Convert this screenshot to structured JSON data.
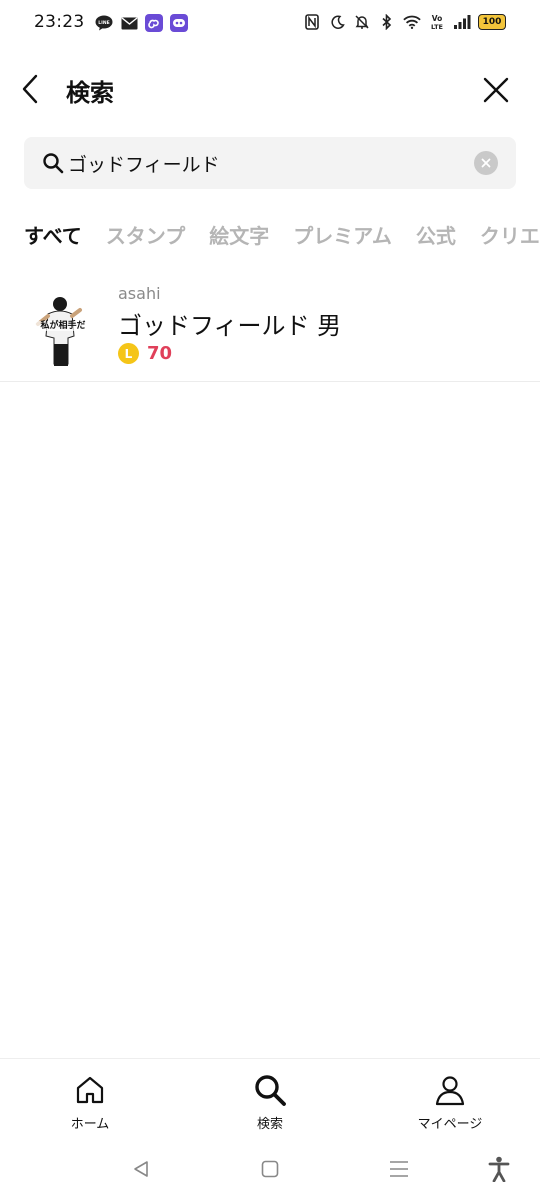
{
  "status_bar": {
    "time": "23:23",
    "battery": "100",
    "left_icons": [
      "line-app-icon",
      "mail-icon",
      "link-app-icon",
      "chat-app-icon"
    ],
    "right_icons": [
      "nfc-icon",
      "moon-icon",
      "mute-icon",
      "bluetooth-icon",
      "wifi-icon",
      "volte-icon",
      "signal-icon",
      "battery-icon"
    ]
  },
  "header": {
    "title": "検索"
  },
  "search": {
    "value": "ゴッドフィールド"
  },
  "tabs": [
    {
      "label": "すべて",
      "active": true
    },
    {
      "label": "スタンプ",
      "active": false
    },
    {
      "label": "絵文字",
      "active": false
    },
    {
      "label": "プレミアム",
      "active": false
    },
    {
      "label": "公式",
      "active": false
    },
    {
      "label": "クリエ",
      "active": false
    }
  ],
  "results": [
    {
      "author": "asahi",
      "title": "ゴッドフィールド 男",
      "coin_label": "L",
      "price": "70",
      "thumb_text": "私が相手だ"
    }
  ],
  "bottom_nav": {
    "home": "ホーム",
    "search": "検索",
    "mypage": "マイページ"
  },
  "colors": {
    "price": "#e0405a",
    "coin": "#f5c518",
    "tab_inactive": "#b5b5b5",
    "search_bg": "#f3f3f3"
  }
}
